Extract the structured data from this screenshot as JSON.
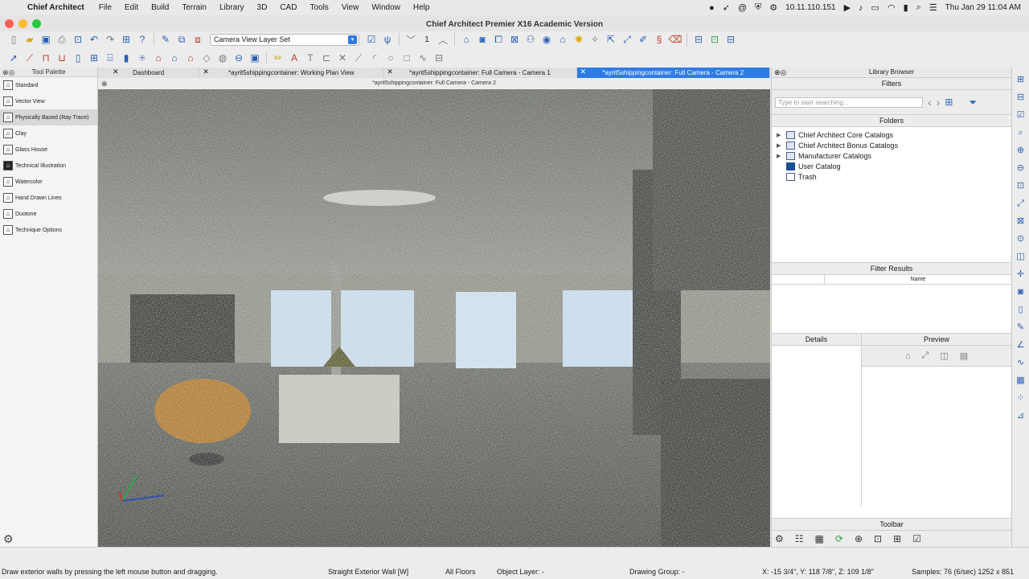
{
  "menubar": {
    "app_name": "Chief Architect",
    "items": [
      "File",
      "Edit",
      "Build",
      "Terrain",
      "Library",
      "3D",
      "CAD",
      "Tools",
      "View",
      "Window",
      "Help"
    ],
    "ip": "10.11.110.151",
    "clock": "Thu Jan 29  11:04 AM"
  },
  "window": {
    "title": "Chief Architect Premier X16 Academic Version"
  },
  "toolbar": {
    "layer_set": "Camera View Layer Set",
    "floor_value": "1"
  },
  "palette": {
    "title": "Tool Palette",
    "items": [
      {
        "label": "Standard"
      },
      {
        "label": "Vector View"
      },
      {
        "label": "Physically Based (Ray Trace)"
      },
      {
        "label": "Clay"
      },
      {
        "label": "Glass House"
      },
      {
        "label": "Technical Illustration"
      },
      {
        "label": "Watercolor"
      },
      {
        "label": "Hand Drawn Lines"
      },
      {
        "label": "Duotone"
      },
      {
        "label": "Technique Options"
      }
    ]
  },
  "tabs": [
    {
      "label": "Dashboard"
    },
    {
      "label": "*ayrit5shippingcontainer:  Working Plan View"
    },
    {
      "label": "*ayrit5shippingcontainer: Full Camera - Camera 1"
    },
    {
      "label": "*ayrit5shippingcontainer: Full Camera - Camera 2"
    }
  ],
  "view_title": "*ayrit5shippingcontainer: Full Camera - Camera 2",
  "library": {
    "title": "Library Browser",
    "filters_label": "Filters",
    "search_placeholder": "Type to start searching...",
    "folders_label": "Folders",
    "folders": [
      {
        "label": "Chief Architect Core Catalogs"
      },
      {
        "label": "Chief Architect Bonus Catalogs"
      },
      {
        "label": "Manufacturer Catalogs"
      },
      {
        "label": "User Catalog"
      },
      {
        "label": "Trash"
      }
    ],
    "filter_results_label": "Filter Results",
    "name_col": "Name",
    "details_label": "Details",
    "preview_label": "Preview",
    "toolbar_label": "Toolbar"
  },
  "status": {
    "hint": "Draw exterior walls by pressing the left mouse button and dragging.",
    "tool": "Straight Exterior Wall [W]",
    "floors": "All Floors",
    "object_layer": "Object Layer: -",
    "drawing_group": "Drawing Group: -",
    "coords": "X: -15 3/4\", Y: 118 7/8\", Z: 109 1/8\"",
    "samples": "Samples: 76 (6/sec)   1252 x 851"
  },
  "colors": {
    "accent": "#2f7be5",
    "close": "#ff5f57",
    "minimize": "#febc2e",
    "zoom": "#28c840"
  }
}
